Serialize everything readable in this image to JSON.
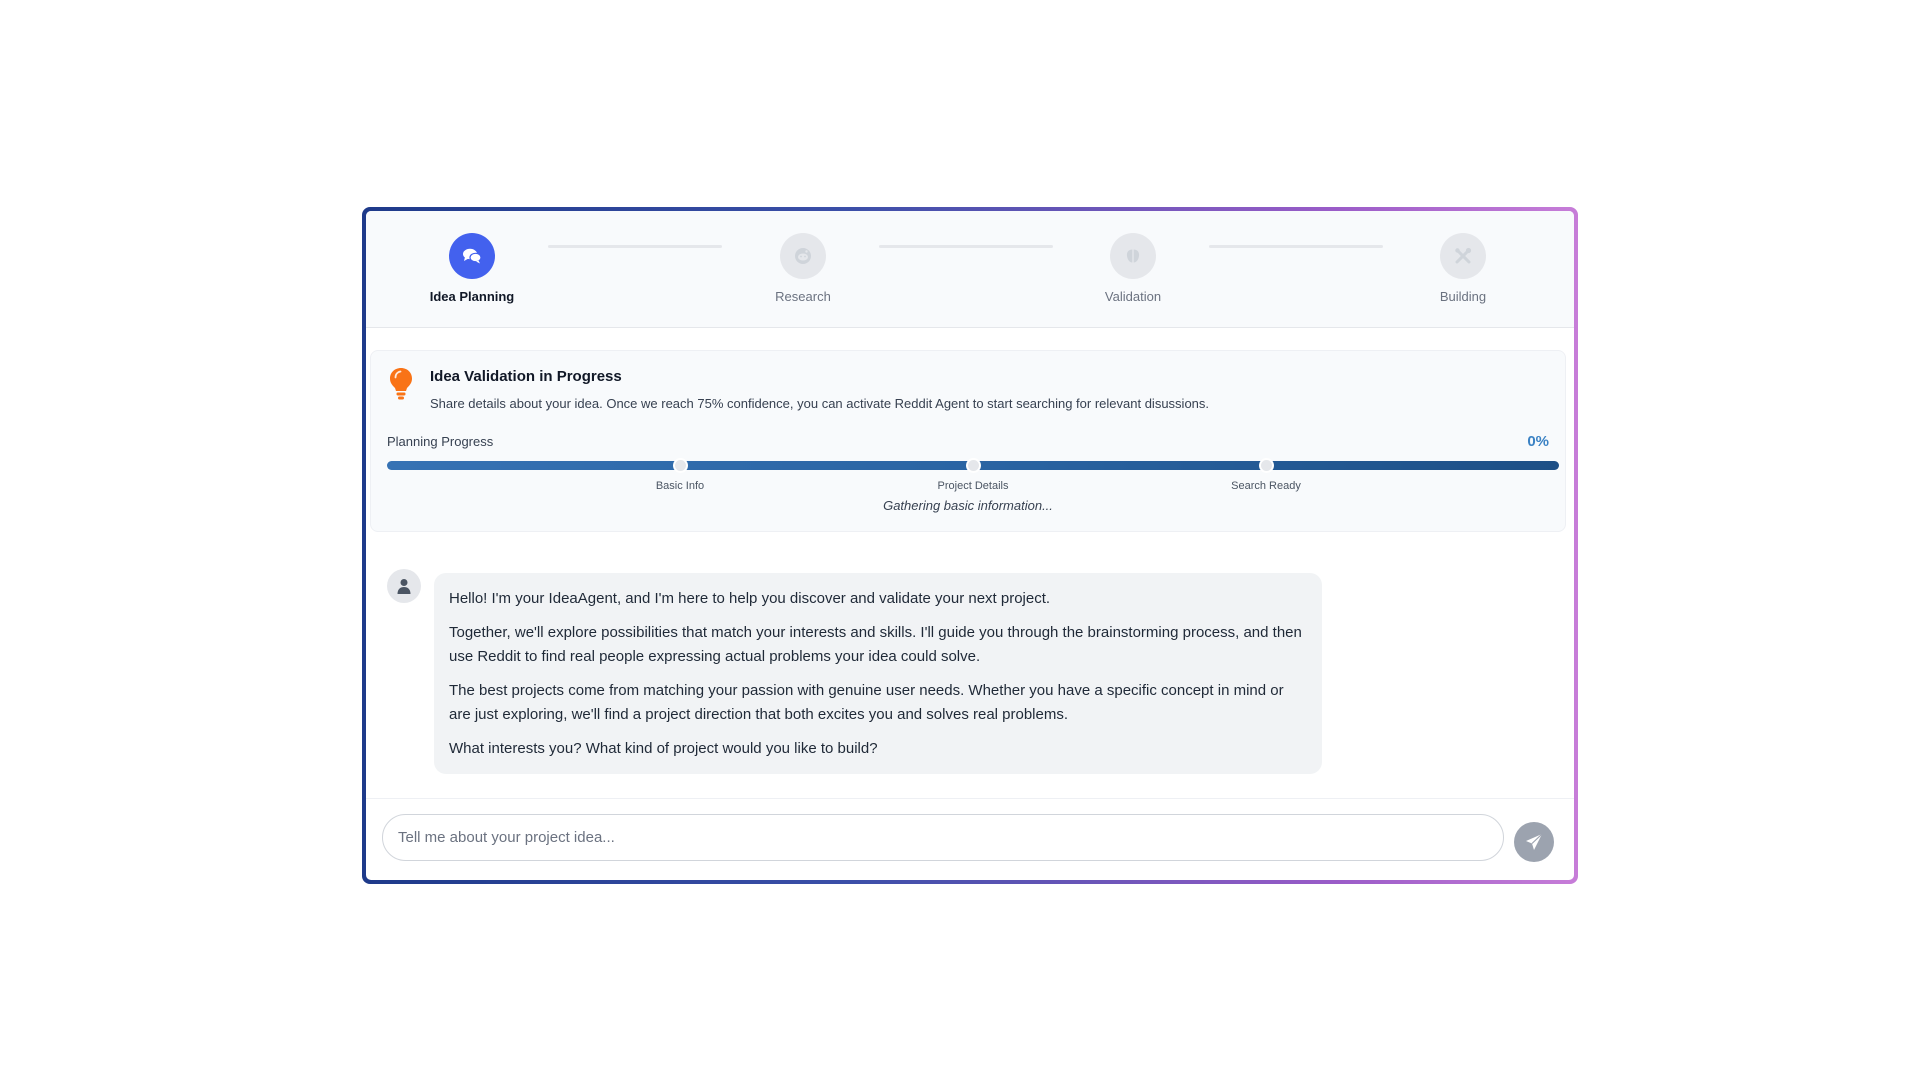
{
  "stepper": {
    "steps": [
      {
        "label": "Idea Planning",
        "icon": "chat-bubbles-icon",
        "active": true
      },
      {
        "label": "Research",
        "icon": "reddit-icon",
        "active": false
      },
      {
        "label": "Validation",
        "icon": "brain-icon",
        "active": false
      },
      {
        "label": "Building",
        "icon": "tools-icon",
        "active": false
      }
    ]
  },
  "validation": {
    "icon": "lightbulb-icon",
    "title": "Idea Validation in Progress",
    "description": "Share details about your idea. Once we reach 75% confidence, you can activate Reddit Agent to start searching for relevant disussions.",
    "progress_label": "Planning Progress",
    "progress_value": "0%",
    "milestones": [
      "Basic Info",
      "Project Details",
      "Search Ready"
    ],
    "status": "Gathering basic information..."
  },
  "chat": {
    "avatar_icon": "user-icon",
    "messages": [
      "Hello! I'm your IdeaAgent, and I'm here to help you discover and validate your next project.",
      "Together, we'll explore possibilities that match your interests and skills. I'll guide you through the brainstorming process, and then use Reddit to find real people expressing actual problems your idea could solve.",
      "The best projects come from matching your passion with genuine user needs. Whether you have a specific concept in mind or are just exploring, we'll find a project direction that both excites you and solves real problems.",
      "What interests you? What kind of project would you like to build?"
    ]
  },
  "input": {
    "placeholder": "Tell me about your project idea...",
    "value": "",
    "send_icon": "paper-plane-icon"
  },
  "colors": {
    "active_step": "#4361ee",
    "progress_bar": "#2a64a3",
    "progress_value": "#3b82c4",
    "bulb": "#f97316",
    "send_button": "#9ca3af"
  }
}
